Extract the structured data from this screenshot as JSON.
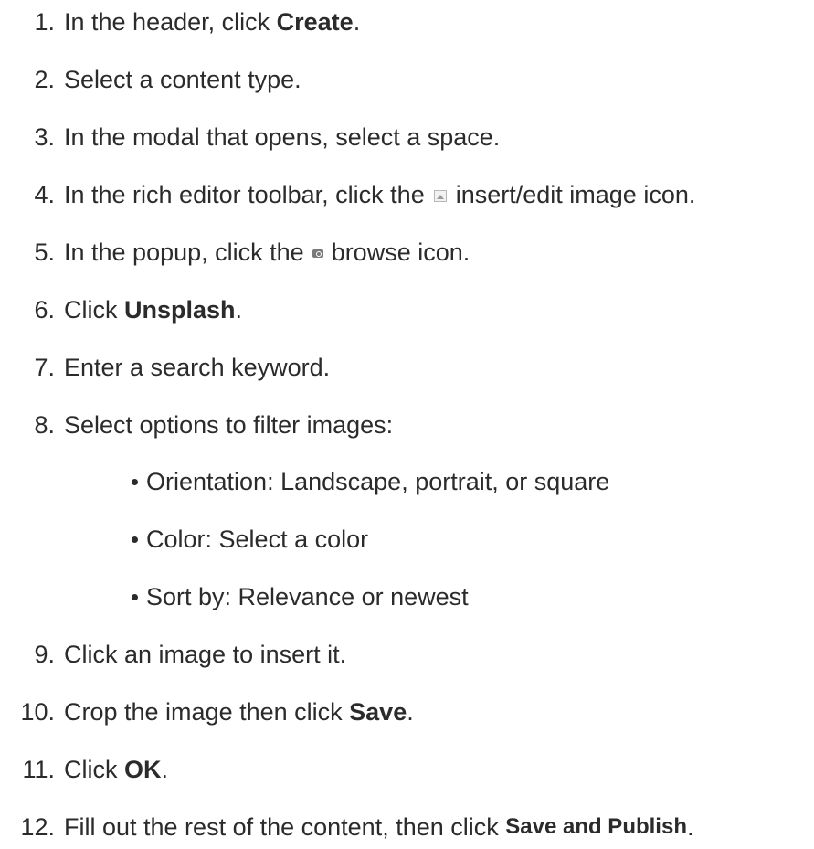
{
  "steps": [
    {
      "num": "1.",
      "before": "In the header, click ",
      "bold": "Create",
      "after": "."
    },
    {
      "num": "2.",
      "text": "Select a content type."
    },
    {
      "num": "3.",
      "text": "In the modal that opens, select a space."
    },
    {
      "num": "4.",
      "before": "In the rich editor toolbar, click the",
      "icon": "insert-edit-image-icon",
      "after": "insert/edit image icon."
    },
    {
      "num": "5.",
      "before": "In the popup, click the",
      "icon": "browse-icon",
      "after": "browse icon."
    },
    {
      "num": "6.",
      "before": "Click ",
      "bold": "Unsplash",
      "after": "."
    },
    {
      "num": "7.",
      "text": "Enter a search keyword."
    },
    {
      "num": "8.",
      "text": "Select options to filter images:"
    },
    {
      "num": "9.",
      "text": "Click an image to insert it."
    },
    {
      "num": "10.",
      "before": "Crop the image then click ",
      "bold": "Save",
      "after": "."
    },
    {
      "num": "11.",
      "before": "Click ",
      "bold": "OK",
      "after": "."
    },
    {
      "num": "12.",
      "before": "Fill out the rest of the content, then click ",
      "bold": "Save and Publish",
      "after": "."
    }
  ],
  "filter_options": [
    "Orientation: Landscape, portrait, or square",
    "Color: Select a color",
    "Sort by: Relevance or newest"
  ]
}
